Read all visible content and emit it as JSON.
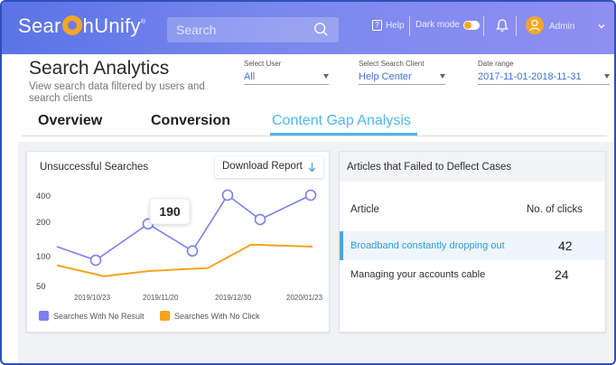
{
  "app": {
    "logo_text_1": "Sear",
    "logo_text_2": "hUnify",
    "logo_mark": "®",
    "search_placeholder": "Search",
    "help_label": "Help",
    "dark_mode_label": "Dark mode",
    "user_name": "Admin"
  },
  "header": {
    "title": "Search Analytics",
    "subtitle": "View search data filtered by users and search clients"
  },
  "filters": [
    {
      "label": "Select User",
      "value": "All"
    },
    {
      "label": "Select Search Client",
      "value": "Help Center"
    },
    {
      "label": "Date range",
      "value": "2017-11-01-2018-11-31"
    }
  ],
  "tabs": [
    {
      "label": "Overview"
    },
    {
      "label": "Conversion"
    },
    {
      "label": "Content Gap Analysis",
      "active": true
    }
  ],
  "unsuccessful": {
    "title": "Unsuccessful Searches",
    "download_label": "Download Report",
    "tooltip_value": "190"
  },
  "chart_data": {
    "type": "line",
    "x_ticks": [
      "2019/10/23",
      "2019/11/20",
      "2019/12/30",
      "2020/01/23"
    ],
    "y_ticks": [
      "400",
      "200",
      "100",
      "50"
    ],
    "series": [
      {
        "name": "Searches With No Result",
        "color": "#7b7ff0",
        "values": [
          120,
          90,
          190,
          110,
          400,
          210,
          400
        ]
      },
      {
        "name": "Searches With No Click",
        "color": "#f5a31c",
        "values": [
          80,
          62,
          70,
          73,
          75,
          125,
          120
        ]
      }
    ]
  },
  "articles": {
    "title": "Articles that Failed to Deflect Cases",
    "col_article": "Article",
    "col_clicks": "No. of clicks",
    "rows": [
      {
        "name": "Broadband constantly dropping out",
        "clicks": "42"
      },
      {
        "name": "Managing your accounts cable",
        "clicks": "24"
      }
    ]
  },
  "colors": {
    "nav_gradient_start": "#5a73e6",
    "accent_blue": "#4fb6f0",
    "no_result": "#7b7ff0",
    "no_click": "#f5a31c"
  }
}
